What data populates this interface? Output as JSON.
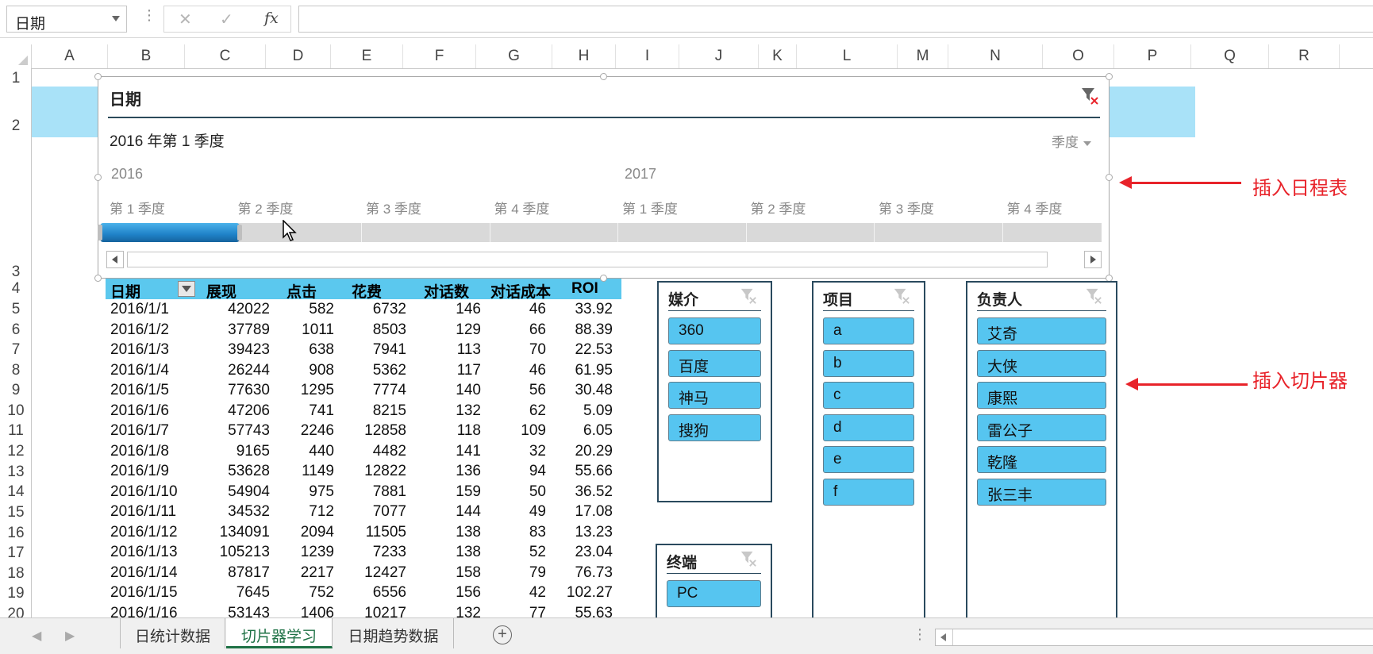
{
  "formula_bar": {
    "name_box": "日期",
    "fx_label": "fx",
    "formula": ""
  },
  "columns": [
    "A",
    "B",
    "C",
    "D",
    "E",
    "F",
    "G",
    "H",
    "I",
    "J",
    "K",
    "L",
    "M",
    "N",
    "O",
    "P",
    "Q",
    "R"
  ],
  "rows": [
    "1",
    "2",
    "3",
    "4",
    "5",
    "6",
    "7",
    "8",
    "9",
    "10",
    "11",
    "12",
    "13",
    "14",
    "15",
    "16",
    "17",
    "18",
    "19",
    "20"
  ],
  "table": {
    "headers": [
      "日期",
      "展现",
      "点击",
      "花费",
      "对话数",
      "对话成本",
      "ROI"
    ],
    "rows": [
      [
        "2016/1/1",
        "42022",
        "582",
        "6732",
        "146",
        "46",
        "33.92"
      ],
      [
        "2016/1/2",
        "37789",
        "1011",
        "8503",
        "129",
        "66",
        "88.39"
      ],
      [
        "2016/1/3",
        "39423",
        "638",
        "7941",
        "113",
        "70",
        "22.53"
      ],
      [
        "2016/1/4",
        "26244",
        "908",
        "5362",
        "117",
        "46",
        "61.95"
      ],
      [
        "2016/1/5",
        "77630",
        "1295",
        "7774",
        "140",
        "56",
        "30.48"
      ],
      [
        "2016/1/6",
        "47206",
        "741",
        "8215",
        "132",
        "62",
        "5.09"
      ],
      [
        "2016/1/7",
        "57743",
        "2246",
        "12858",
        "118",
        "109",
        "6.05"
      ],
      [
        "2016/1/8",
        "9165",
        "440",
        "4482",
        "141",
        "32",
        "20.29"
      ],
      [
        "2016/1/9",
        "53628",
        "1149",
        "12822",
        "136",
        "94",
        "55.66"
      ],
      [
        "2016/1/10",
        "54904",
        "975",
        "7881",
        "159",
        "50",
        "36.52"
      ],
      [
        "2016/1/11",
        "34532",
        "712",
        "7077",
        "144",
        "49",
        "17.08"
      ],
      [
        "2016/1/12",
        "134091",
        "2094",
        "11505",
        "138",
        "83",
        "13.23"
      ],
      [
        "2016/1/13",
        "105213",
        "1239",
        "7233",
        "138",
        "52",
        "23.04"
      ],
      [
        "2016/1/14",
        "87817",
        "2217",
        "12427",
        "158",
        "79",
        "76.73"
      ],
      [
        "2016/1/15",
        "7645",
        "752",
        "6556",
        "156",
        "42",
        "102.27"
      ],
      [
        "2016/1/16",
        "53143",
        "1406",
        "10217",
        "132",
        "77",
        "55.63"
      ]
    ]
  },
  "timeline": {
    "title": "日期",
    "selection": "2016 年第 1 季度",
    "level": "季度",
    "years": [
      "2016",
      "2017"
    ],
    "quarters": [
      "第 1 季度",
      "第 2 季度",
      "第 3 季度",
      "第 4 季度",
      "第 1 季度",
      "第 2 季度",
      "第 3 季度",
      "第 4 季度"
    ],
    "selected_quarters": 1
  },
  "slicers": {
    "media": {
      "title": "媒介",
      "items": [
        "360",
        "百度",
        "神马",
        "搜狗"
      ]
    },
    "terminal": {
      "title": "终端",
      "items": [
        "PC"
      ]
    },
    "project": {
      "title": "项目",
      "items": [
        "a",
        "b",
        "c",
        "d",
        "e",
        "f"
      ]
    },
    "owner": {
      "title": "负责人",
      "items": [
        "艾奇",
        "大侠",
        "康熙",
        "雷公子",
        "乾隆",
        "张三丰"
      ]
    }
  },
  "annotations": {
    "timeline": "插入日程表",
    "slicer": "插入切片器"
  },
  "sheet_tabs": [
    {
      "label": "日统计数据",
      "active": false
    },
    {
      "label": "切片器学习",
      "active": true
    },
    {
      "label": "日期趋势数据",
      "active": false
    }
  ],
  "colors": {
    "header_fill": "#5bc8ee",
    "slicer_item": "#56c5f0",
    "timeline_bar": "#1f82c8",
    "annotation": "#e8232a",
    "active_tab": "#1e7145"
  }
}
